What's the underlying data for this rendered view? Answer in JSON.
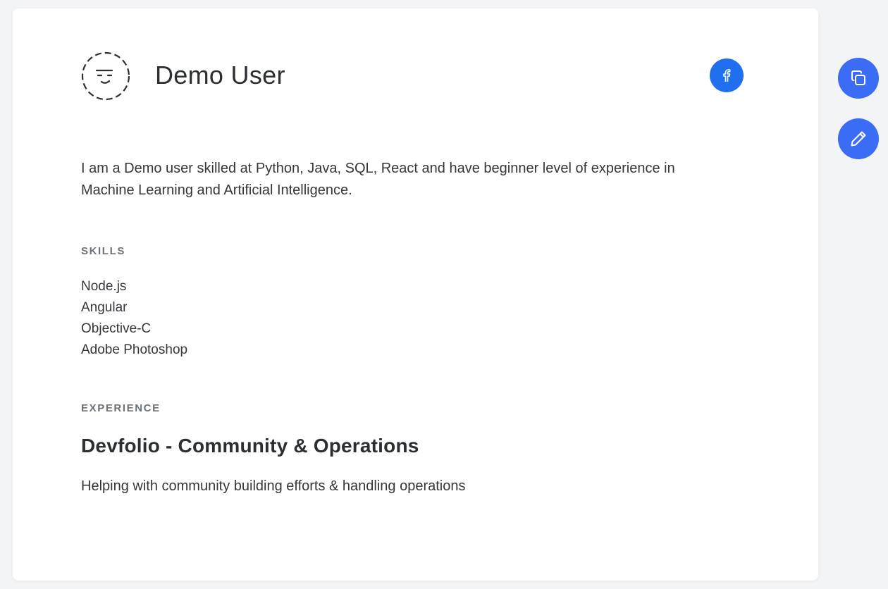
{
  "profile": {
    "name": "Demo User",
    "avatar_icon": "dashed-face-avatar",
    "social": {
      "facebook_icon": "facebook-icon"
    },
    "bio": "I am a Demo user skilled at Python, Java, SQL, React and have beginner level of experience in Machine Learning and Artificial Intelligence."
  },
  "skills": {
    "title": "SKILLS",
    "items": [
      "Node.js",
      "Angular",
      "Objective-C",
      "Adobe Photoshop"
    ]
  },
  "experience": {
    "title": "EXPERIENCE",
    "role": "Devfolio - Community & Operations",
    "description": "Helping with community building efforts & handling operations"
  },
  "actions": {
    "copy_icon": "copy-icon",
    "edit_icon": "pencil-icon"
  },
  "colors": {
    "accent": "#3b6cf6",
    "facebook": "#1f6fef",
    "background": "#f3f4f6",
    "card": "#ffffff"
  }
}
